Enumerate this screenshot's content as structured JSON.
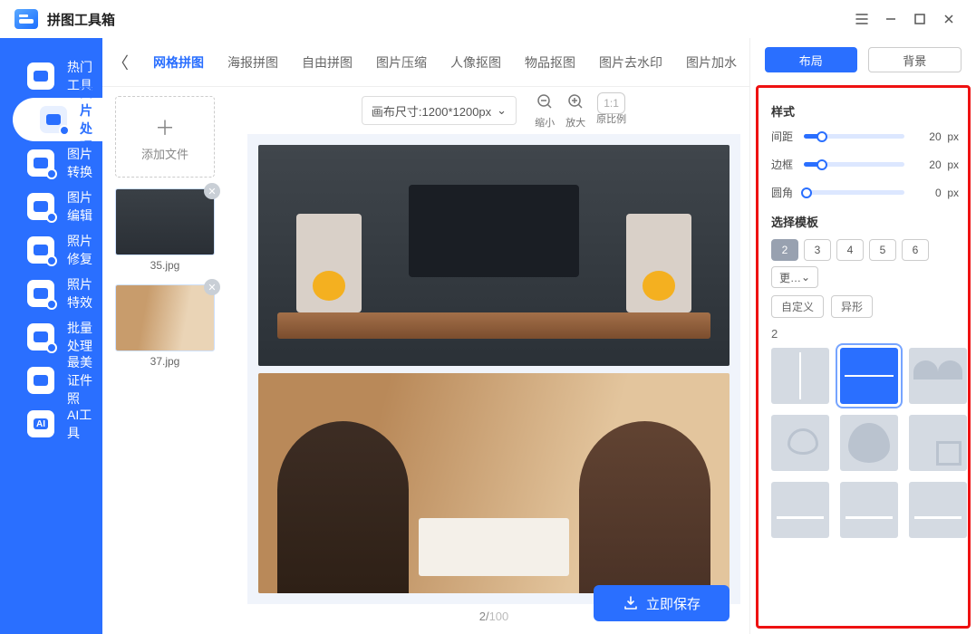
{
  "app": {
    "title": "拼图工具箱"
  },
  "sidebar": {
    "items": [
      {
        "label": "热门工具"
      },
      {
        "label": "图片处理"
      },
      {
        "label": "图片转换"
      },
      {
        "label": "图片编辑"
      },
      {
        "label": "照片修复"
      },
      {
        "label": "照片特效"
      },
      {
        "label": "批量处理"
      },
      {
        "label": "最美证件照"
      },
      {
        "label": "AI工具"
      }
    ],
    "active_index": 1
  },
  "tabs": {
    "items": [
      "网格拼图",
      "海报拼图",
      "自由拼图",
      "图片压缩",
      "人像抠图",
      "物品抠图",
      "图片去水印",
      "图片加水"
    ],
    "active_index": 0
  },
  "canvas": {
    "size_label": "画布尺寸:1200*1200px",
    "zoom_out_label": "缩小",
    "zoom_in_label": "放大",
    "ratio_label": "1:1",
    "orig_ratio_label": "原比例",
    "add_file_label": "添加文件",
    "thumbs": [
      {
        "name": "35.jpg"
      },
      {
        "name": "37.jpg"
      }
    ],
    "page_current": "2",
    "page_total": "100",
    "save_label": "立即保存"
  },
  "panel": {
    "tab_layout": "布局",
    "tab_background": "背景",
    "section_style": "样式",
    "sliders": {
      "gap": {
        "label": "间距",
        "value": 20,
        "unit": "px",
        "fill_pct": 18
      },
      "border": {
        "label": "边框",
        "value": 20,
        "unit": "px",
        "fill_pct": 18
      },
      "radius": {
        "label": "圆角",
        "value": 0,
        "unit": "px",
        "fill_pct": 3
      }
    },
    "section_template": "选择模板",
    "count_tabs": [
      "2",
      "3",
      "4",
      "5",
      "6"
    ],
    "count_more": "更…",
    "count_active_index": 0,
    "chip_custom": "自定义",
    "chip_irregular": "异形",
    "count_display": "2"
  }
}
